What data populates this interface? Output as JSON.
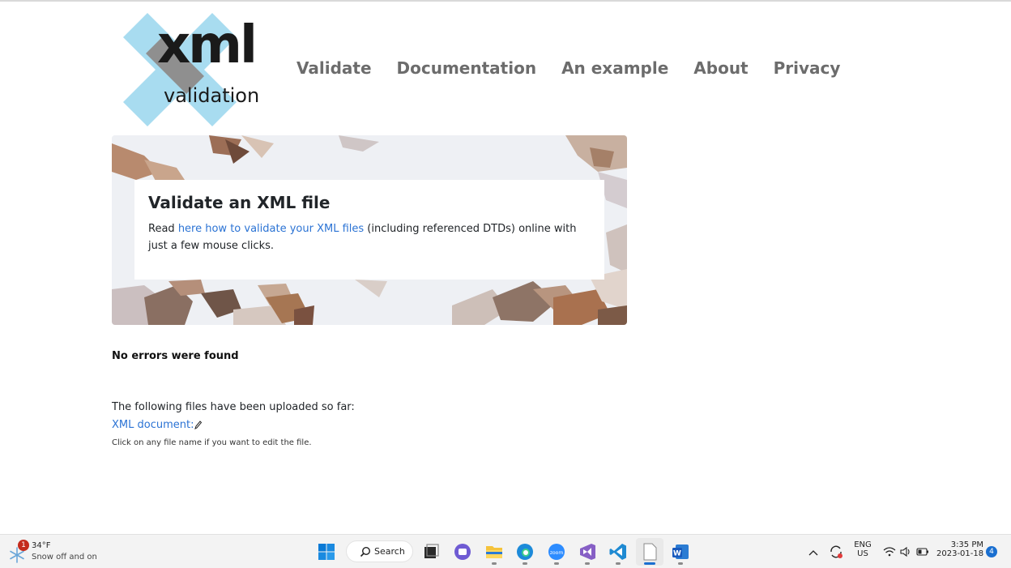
{
  "logo": {
    "word": "xml",
    "sub": "validation"
  },
  "nav": {
    "items": [
      "Validate",
      "Documentation",
      "An example",
      "About",
      "Privacy"
    ]
  },
  "hero": {
    "title": "Validate an XML file",
    "text_before": "Read ",
    "link_text": "here how to validate your XML files",
    "text_after": " (including referenced DTDs) online with just a few mouse clicks."
  },
  "status": "No errors were found",
  "uploaded": {
    "intro": "The following files have been uploaded so far:",
    "file_link": "XML document:",
    "hint": "Click on any file name if you want to edit the file."
  },
  "taskbar": {
    "weather_badge": "1",
    "weather_temp": "34°F",
    "weather_desc": "Snow off and on",
    "search_label": "Search",
    "lang_top": "ENG",
    "lang_bottom": "US",
    "time": "3:35 PM",
    "date": "2023-01-18",
    "notif_count": "4"
  },
  "colors": {
    "link": "#2b73d4",
    "nav": "#6c6c6c",
    "logo_x": "#a8dcf0",
    "logo_x_dark": "#8f8f8f"
  },
  "icons": [
    "weather-snow-icon",
    "windows-start-icon",
    "search-icon",
    "task-view-icon",
    "chat-icon",
    "file-explorer-icon",
    "edge-icon",
    "zoom-icon",
    "visual-studio-icon",
    "vscode-icon",
    "notepad-icon",
    "word-icon",
    "chevron-up-icon",
    "sync-icon",
    "wifi-icon",
    "volume-icon",
    "battery-icon",
    "edit-pencil-icon"
  ]
}
